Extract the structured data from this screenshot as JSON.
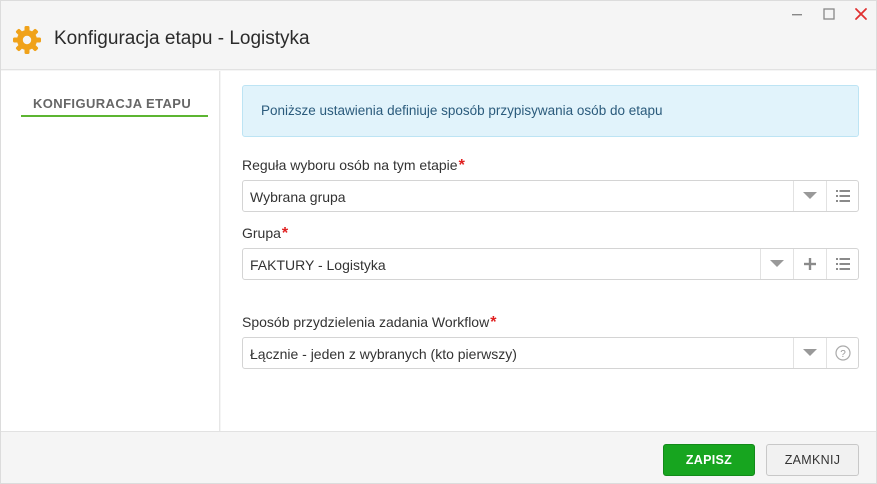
{
  "window": {
    "title": "Konfiguracja etapu - Logistyka",
    "title_icon": "gear-icon",
    "controls": [
      "minimize-icon",
      "maximize-icon",
      "close-icon"
    ]
  },
  "sidebar": {
    "items": [
      {
        "label": "KONFIGURACJA ETAPU",
        "active": true
      }
    ]
  },
  "main": {
    "info_text": "Poniższe ustawienia definiuje sposób przypisywania osób do etapu",
    "fields": [
      {
        "label": "Reguła wyboru osób na tym etapie",
        "required_mark": "*",
        "value": "Wybrana grupa",
        "buttons": [
          "chevron-down-icon",
          "list-icon"
        ]
      },
      {
        "label": "Grupa",
        "required_mark": "*",
        "value": "FAKTURY - Logistyka",
        "buttons": [
          "chevron-down-icon",
          "plus-icon",
          "list-icon"
        ]
      },
      {
        "label": "Sposób przydzielenia zadania Workflow",
        "required_mark": "*",
        "value": "Łącznie - jeden z wybranych (kto pierwszy)",
        "buttons": [
          "chevron-down-icon",
          "help-icon"
        ]
      }
    ]
  },
  "footer": {
    "save_label": "ZAPISZ",
    "close_label": "ZAMKNIJ"
  },
  "colors": {
    "accent_green": "#17a51f",
    "tab_underline": "#5cb531",
    "gear_orange": "#f0a21a",
    "close_red": "#e03030",
    "info_bg": "#e1f3fb"
  }
}
